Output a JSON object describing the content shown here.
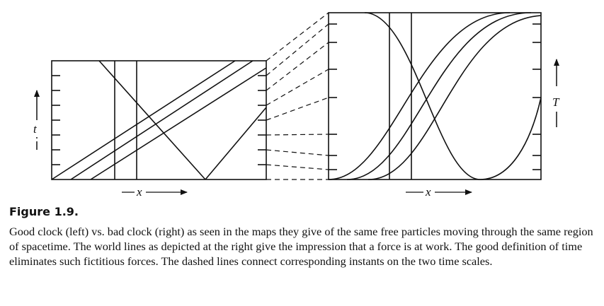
{
  "figure": {
    "label": "Figure 1.9.",
    "caption": "Good clock (left) vs. bad clock (right) as seen in the maps they give of the same free particles moving through the same region of spacetime. The world lines as depicted at the right give the impression that a force is at work. The good definition of time eliminates such fictitious forces. The dashed lines connect corresponding instants on the two time scales."
  },
  "left_panel": {
    "x_axis_label": "x",
    "t_axis_label": "t"
  },
  "right_panel": {
    "x_axis_label": "x",
    "t_axis_label": "T"
  }
}
